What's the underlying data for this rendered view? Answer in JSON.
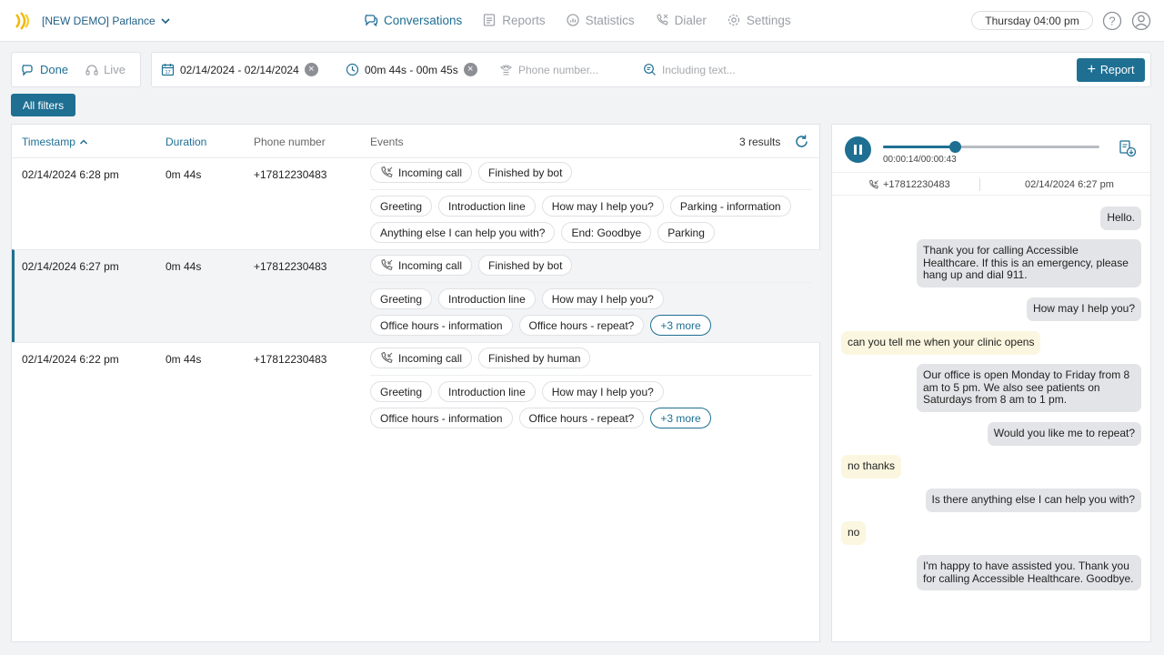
{
  "header": {
    "workspace": "[NEW DEMO] Parlance",
    "nav": [
      {
        "label": "Conversations",
        "icon": "conversations-icon",
        "active": true
      },
      {
        "label": "Reports",
        "icon": "reports-icon",
        "active": false
      },
      {
        "label": "Statistics",
        "icon": "statistics-icon",
        "active": false
      },
      {
        "label": "Dialer",
        "icon": "dialer-icon",
        "active": false
      },
      {
        "label": "Settings",
        "icon": "gear-icon",
        "active": false
      }
    ],
    "datetime": "Thursday 04:00 pm"
  },
  "toggle": {
    "done": "Done",
    "live": "Live"
  },
  "filters": {
    "date_range": "02/14/2024 - 02/14/2024",
    "duration_range": "00m 44s - 00m 45s",
    "phone_placeholder": "Phone number...",
    "text_placeholder": "Including text...",
    "report_label": "Report",
    "all_filters_label": "All filters"
  },
  "table": {
    "headers": {
      "timestamp": "Timestamp",
      "duration": "Duration",
      "phone": "Phone number",
      "events": "Events"
    },
    "results": "3 results",
    "rows": [
      {
        "timestamp": "02/14/2024 6:28 pm",
        "duration": "0m 44s",
        "phone": "+17812230483",
        "chips": [
          [
            "Incoming call",
            "Finished by bot"
          ],
          [
            "Greeting",
            "Introduction line",
            "How may I help you?",
            "Parking - information"
          ],
          [
            "Anything else I can help you with?",
            "End: Goodbye",
            "Parking"
          ]
        ]
      },
      {
        "timestamp": "02/14/2024 6:27 pm",
        "duration": "0m 44s",
        "phone": "+17812230483",
        "chips": [
          [
            "Incoming call",
            "Finished by bot"
          ],
          [
            "Greeting",
            "Introduction line",
            "How may I help you?"
          ],
          [
            "Office hours - information",
            "Office hours - repeat?",
            "+3 more"
          ]
        ]
      },
      {
        "timestamp": "02/14/2024 6:22 pm",
        "duration": "0m 44s",
        "phone": "+17812230483",
        "chips": [
          [
            "Incoming call",
            "Finished by human"
          ],
          [
            "Greeting",
            "Introduction line",
            "How may I help you?"
          ],
          [
            "Office hours - information",
            "Office hours - repeat?",
            "+3 more"
          ]
        ]
      }
    ]
  },
  "player": {
    "time": "00:00:14/00:00:43",
    "progress": 0.33,
    "phone": "+17812230483",
    "date": "02/14/2024 6:27 pm"
  },
  "transcript": [
    {
      "speaker": "bot",
      "text": "Hello."
    },
    {
      "speaker": "bot",
      "text": "Thank you for calling Accessible Healthcare. If this is an emergency, please hang up and dial 911."
    },
    {
      "speaker": "bot",
      "text": "How may I help you?"
    },
    {
      "speaker": "user",
      "text": "can you tell me when your clinic opens"
    },
    {
      "speaker": "bot",
      "text": "Our office is open Monday to Friday from 8 am to 5 pm. We also see patients on Saturdays from 8 am to 1 pm."
    },
    {
      "speaker": "bot",
      "text": "Would you like me to repeat?"
    },
    {
      "speaker": "user",
      "text": "no thanks"
    },
    {
      "speaker": "bot",
      "text": "Is there anything else I can help you with?"
    },
    {
      "speaker": "user",
      "text": "no"
    },
    {
      "speaker": "bot",
      "text": "I'm happy to have assisted you. Thank you for calling Accessible Healthcare. Goodbye."
    }
  ]
}
